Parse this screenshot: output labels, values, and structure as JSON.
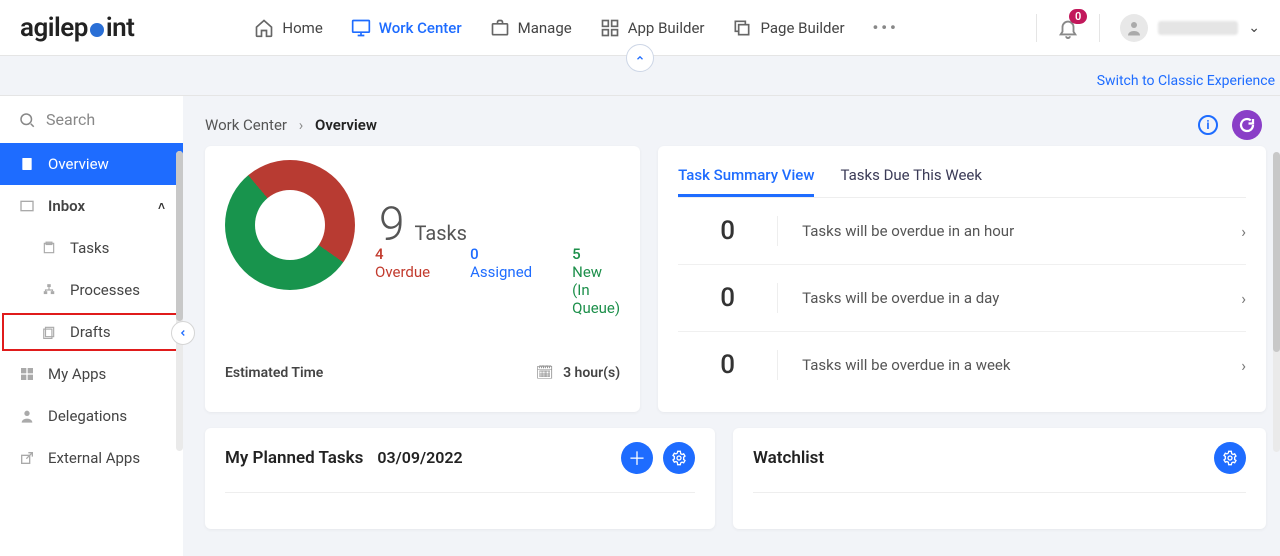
{
  "header": {
    "logo_text_pre": "agilep",
    "logo_text_post": "int",
    "nav": [
      {
        "label": "Home"
      },
      {
        "label": "Work Center",
        "active": true
      },
      {
        "label": "Manage"
      },
      {
        "label": "App Builder"
      },
      {
        "label": "Page Builder"
      }
    ],
    "notif_badge": "0"
  },
  "band": {
    "switch_link": "Switch to Classic Experience"
  },
  "sidebar": {
    "search_placeholder": "Search",
    "items": [
      {
        "label": "Overview"
      },
      {
        "label": "Inbox"
      },
      {
        "label": "Tasks"
      },
      {
        "label": "Processes"
      },
      {
        "label": "Drafts"
      },
      {
        "label": "My Apps"
      },
      {
        "label": "Delegations"
      },
      {
        "label": "External Apps"
      }
    ]
  },
  "breadcrumb": {
    "root": "Work Center",
    "current": "Overview"
  },
  "tasks_card": {
    "total": "9",
    "total_label": "Tasks",
    "overdue_n": "4",
    "overdue_label": "Overdue",
    "assigned_n": "0",
    "assigned_label": "Assigned",
    "new_n": "5",
    "new_label": "New",
    "new_sub": "(In Queue)",
    "est_label": "Estimated Time",
    "est_value": "3 hour(s)"
  },
  "summary_card": {
    "tab1": "Task Summary View",
    "tab2": "Tasks Due This Week",
    "rows": [
      {
        "n": "0",
        "t": "Tasks will be overdue in an hour"
      },
      {
        "n": "0",
        "t": "Tasks will be overdue in a day"
      },
      {
        "n": "0",
        "t": "Tasks will be overdue in a week"
      }
    ]
  },
  "planned": {
    "title": "My Planned Tasks",
    "date": "03/09/2022"
  },
  "watch": {
    "title": "Watchlist"
  },
  "chart_data": {
    "type": "pie",
    "title": "Tasks",
    "total": 9,
    "series": [
      {
        "name": "Overdue",
        "value": 4,
        "color": "#b83b32"
      },
      {
        "name": "Assigned",
        "value": 0,
        "color": "#1e6cff"
      },
      {
        "name": "New (In Queue)",
        "value": 5,
        "color": "#18944d"
      }
    ],
    "donut": true
  }
}
